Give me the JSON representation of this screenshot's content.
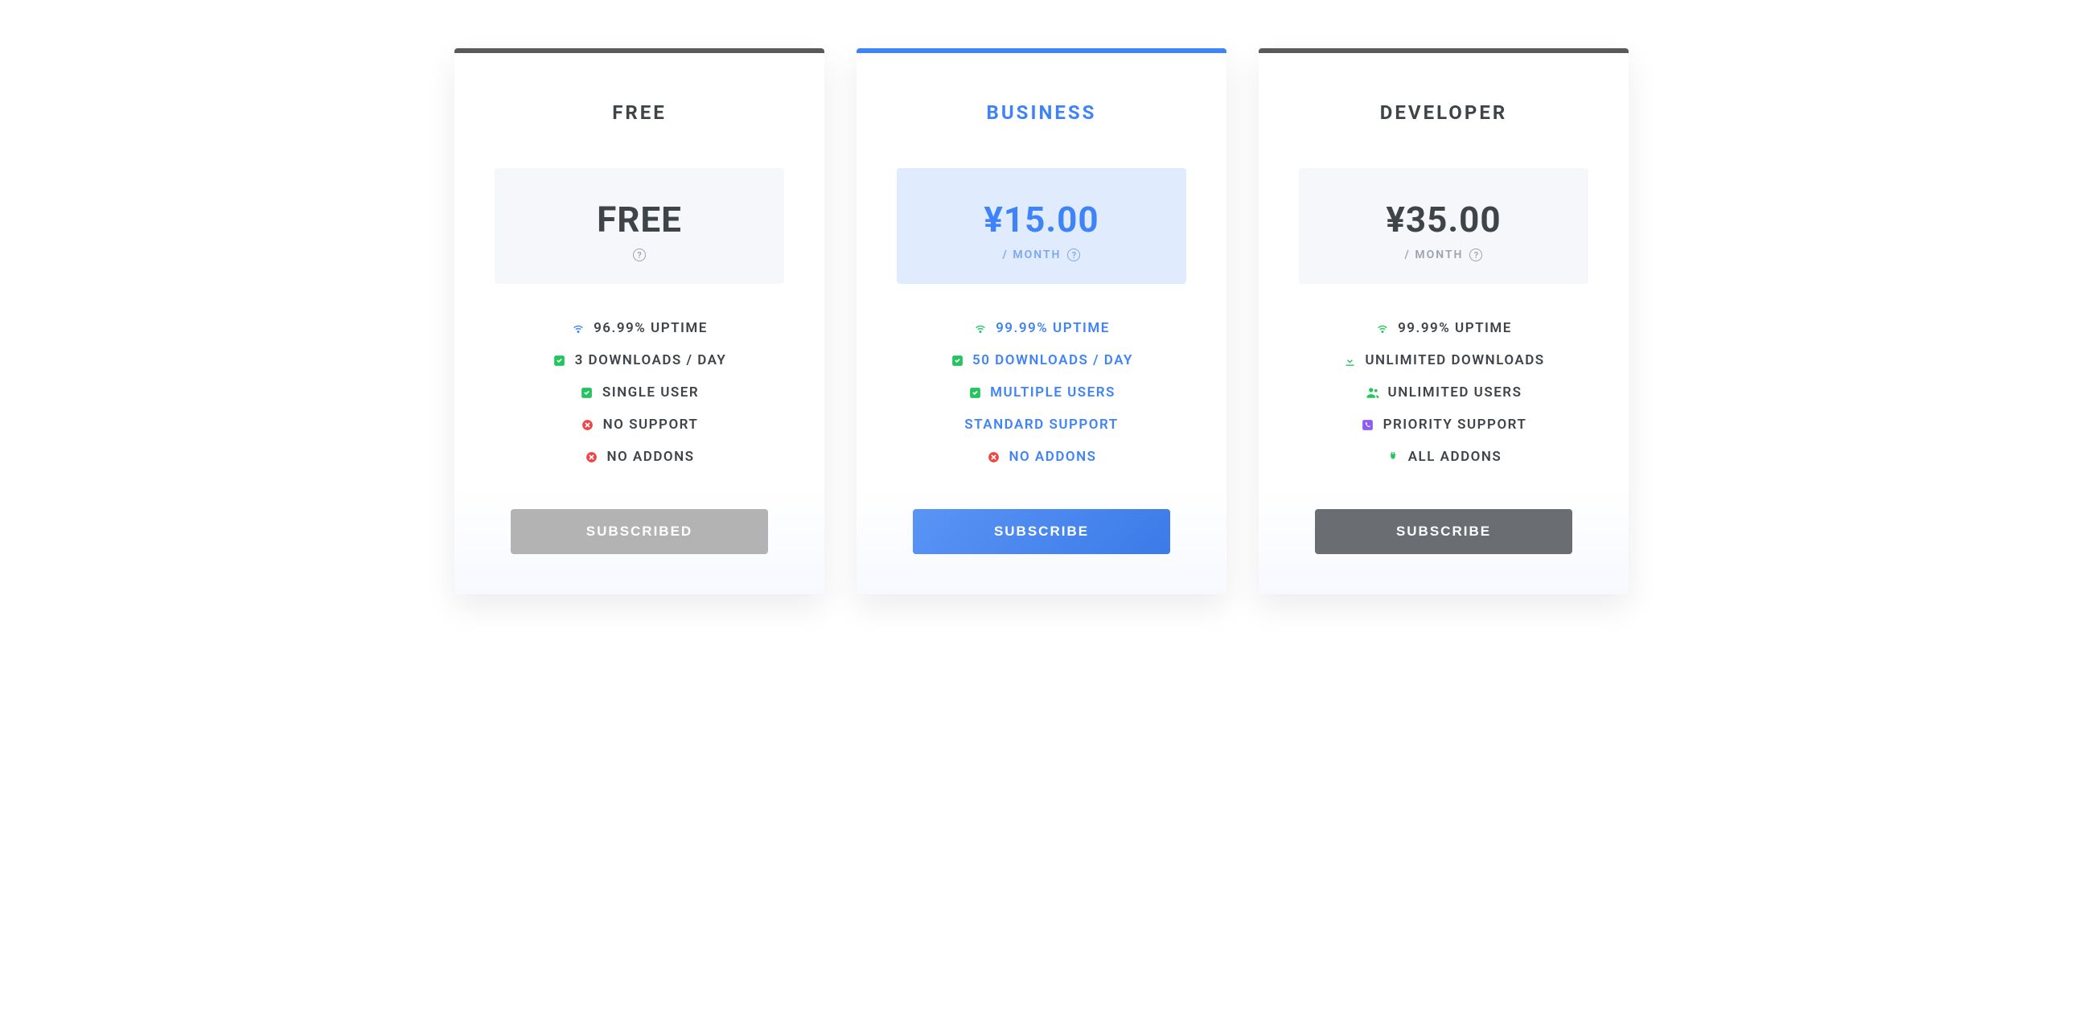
{
  "plans": [
    {
      "title": "FREE",
      "price": "FREE",
      "period": "",
      "features": [
        {
          "icon": "wifi",
          "color": "#3f83f8",
          "text": "96.99% UPTIME"
        },
        {
          "icon": "check-square",
          "color": "#22c55e",
          "text": "3 DOWNLOADS / DAY"
        },
        {
          "icon": "check-square",
          "color": "#22c55e",
          "text": "SINGLE USER"
        },
        {
          "icon": "x-circle",
          "color": "#ef4444",
          "text": "NO SUPPORT"
        },
        {
          "icon": "x-circle",
          "color": "#ef4444",
          "text": "NO ADDONS"
        }
      ],
      "button_label": "SUBSCRIBED",
      "button_state": "disabled"
    },
    {
      "title": "BUSINESS",
      "price": "¥15.00",
      "period": "/ MONTH",
      "featured": true,
      "features": [
        {
          "icon": "wifi",
          "color": "#22c55e",
          "text": "99.99% UPTIME"
        },
        {
          "icon": "check-square",
          "color": "#22c55e",
          "text": "50 DOWNLOADS / DAY"
        },
        {
          "icon": "check-square",
          "color": "#22c55e",
          "text": "MULTIPLE USERS"
        },
        {
          "icon": "none",
          "color": "",
          "text": "STANDARD SUPPORT"
        },
        {
          "icon": "x-circle",
          "color": "#ef4444",
          "text": "NO ADDONS"
        }
      ],
      "button_label": "SUBSCRIBE",
      "button_state": "primary"
    },
    {
      "title": "DEVELOPER",
      "price": "¥35.00",
      "period": "/ MONTH",
      "features": [
        {
          "icon": "wifi",
          "color": "#22c55e",
          "text": "99.99% UPTIME"
        },
        {
          "icon": "download",
          "color": "#22c55e",
          "text": "UNLIMITED DOWNLOADS"
        },
        {
          "icon": "users",
          "color": "#22c55e",
          "text": "UNLIMITED USERS"
        },
        {
          "icon": "phone-square",
          "color": "#8b5cf6",
          "text": "PRIORITY SUPPORT"
        },
        {
          "icon": "plug",
          "color": "#22c55e",
          "text": "ALL ADDONS"
        }
      ],
      "button_label": "SUBSCRIBE",
      "button_state": "default"
    }
  ]
}
